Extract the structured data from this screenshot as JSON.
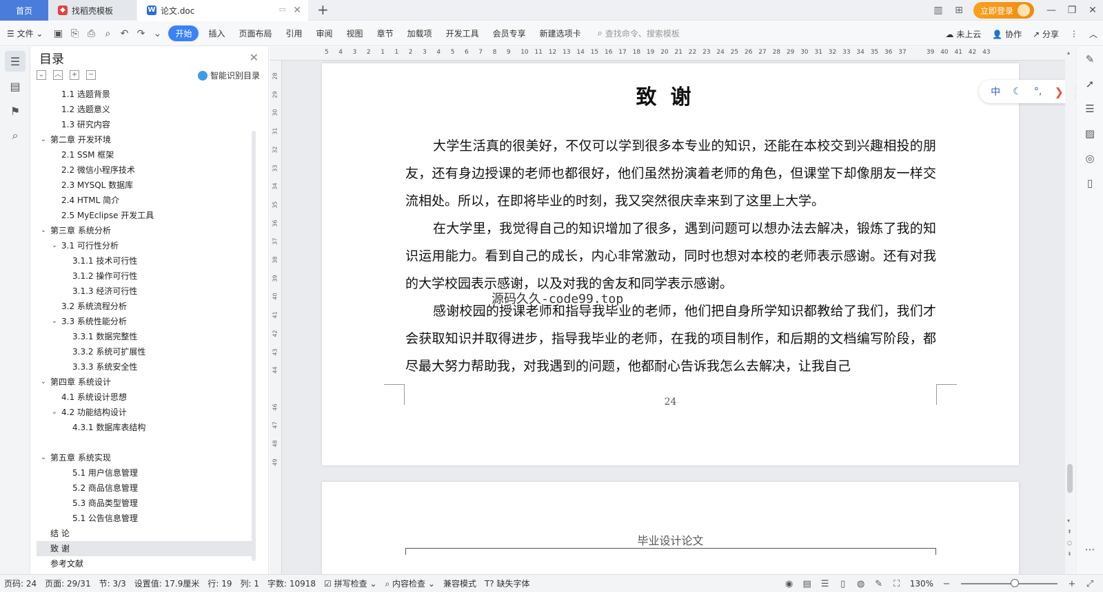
{
  "tabs": {
    "home": "首页",
    "template": "找稻壳模板",
    "document": "论文.doc"
  },
  "titlebar": {
    "login": "立即登录"
  },
  "menu": {
    "file": "文件",
    "items": [
      "开始",
      "插入",
      "页面布局",
      "引用",
      "审阅",
      "视图",
      "章节",
      "加载项",
      "开发工具",
      "会员专享",
      "新建选项卡"
    ],
    "search_placeholder": "查找命令、搜索模板",
    "cloud": "未上云",
    "collab": "协作",
    "share": "分享"
  },
  "toc": {
    "title": "目录",
    "smart": "智能识别目录",
    "items": [
      {
        "label": "1.1 选题背景",
        "level": 2
      },
      {
        "label": "1.2  选题意义",
        "level": 2
      },
      {
        "label": "1.3  研究内容",
        "level": 2
      },
      {
        "label": "第二章  开发环境",
        "level": 1,
        "expanded": true
      },
      {
        "label": "2.1 SSM 框架",
        "level": 2
      },
      {
        "label": "2.2 微信小程序技术",
        "level": 2
      },
      {
        "label": "2.3 MYSQL 数据库",
        "level": 2
      },
      {
        "label": "2.4 HTML 简介",
        "level": 2
      },
      {
        "label": "2.5 MyEclipse 开发工具",
        "level": 2
      },
      {
        "label": "第三章  系统分析",
        "level": 1,
        "expanded": true
      },
      {
        "label": "3.1 可行性分析",
        "level": 2,
        "expanded": true
      },
      {
        "label": "3.1.1 技术可行性",
        "level": 3
      },
      {
        "label": "3.1.2 操作可行性",
        "level": 3
      },
      {
        "label": "3.1.3 经济可行性",
        "level": 3
      },
      {
        "label": "3.2 系统流程分析",
        "level": 2
      },
      {
        "label": "3.3 系统性能分析",
        "level": 2,
        "expanded": true
      },
      {
        "label": "3.3.1 数据完整性",
        "level": 3
      },
      {
        "label": "3.3.2 系统可扩展性",
        "level": 3
      },
      {
        "label": "3.3.3 系统安全性",
        "level": 3
      },
      {
        "label": "第四章  系统设计",
        "level": 1,
        "expanded": true
      },
      {
        "label": "4.1  系统设计思想",
        "level": 2
      },
      {
        "label": "4.2 功能结构设计",
        "level": 2,
        "expanded": true
      },
      {
        "label": "4.3.1  数据库表结构",
        "level": 3
      },
      {
        "label": "",
        "level": 2
      },
      {
        "label": "第五章  系统实现",
        "level": 1,
        "expanded": true
      },
      {
        "label": "5.1 用户信息管理",
        "level": 3
      },
      {
        "label": "5.2  商品信息管理",
        "level": 3
      },
      {
        "label": "5.3 商品类型管理",
        "level": 3
      },
      {
        "label": "5.1 公告信息管理",
        "level": 3
      },
      {
        "label": "结    论",
        "level": 1
      },
      {
        "label": "致    谢",
        "level": 1,
        "selected": true
      },
      {
        "label": "参考文献",
        "level": 1
      }
    ]
  },
  "ruler": {
    "h": [
      "5",
      "4",
      "3",
      "2",
      "1",
      "1",
      "2",
      "3",
      "4",
      "5",
      "6",
      "7",
      "8",
      "9",
      "10",
      "11",
      "12",
      "13",
      "14",
      "15",
      "16",
      "17",
      "18",
      "19",
      "20",
      "21",
      "22",
      "23",
      "24",
      "25",
      "26",
      "27",
      "28",
      "29",
      "30",
      "31",
      "32",
      "33",
      "34",
      "35",
      "36",
      "37",
      "",
      "39",
      "40",
      "41",
      "42",
      "43"
    ],
    "v": [
      "28",
      "29",
      "30",
      "31",
      "32",
      "33",
      "34",
      "35",
      "36",
      "37",
      "38",
      "39",
      "40",
      "41",
      "42",
      "43",
      "44",
      "",
      "46",
      "47",
      "48",
      "49"
    ]
  },
  "document": {
    "title": "致谢",
    "paragraphs": [
      "大学生活真的很美好，不仅可以学到很多本专业的知识，还能在本校交到兴趣相投的朋友，还有身边授课的老师也都很好，他们虽然扮演着老师的角色，但课堂下却像朋友一样交流相处。所以，在即将毕业的时刻，我又突然很庆幸来到了这里上大学。",
      "在大学里，我觉得自己的知识增加了很多，遇到问题可以想办法去解决，锻炼了我的知识运用能力。看到自己的成长，内心非常激动，同时也想对本校的老师表示感谢。还有对我的大学校园表示感谢，以及对我的舍友和同学表示感谢。",
      "感谢校园的授课老师和指导我毕业的老师，他们把自身所学知识都教给了我们，我们才会获取知识并取得进步，指导我毕业的老师，在我的项目制作，和后期的文档编写阶段，都尽最大努力帮助我，对我遇到的问题，他都耐心告诉我怎么去解决，让我自己"
    ],
    "watermark": "源码久久-code99.top",
    "page_number": "24",
    "next_header": "毕业设计论文"
  },
  "lang_float": {
    "lang": "中"
  },
  "status": {
    "page_code": "页码: 24",
    "page": "页面: 29/31",
    "section": "节: 3/3",
    "setting": "设置值: 17.9厘米",
    "row": "行: 19",
    "col": "列: 1",
    "words": "字数: 10918",
    "spell": "拼写检查",
    "content": "内容检查",
    "compat": "兼容模式",
    "missing_font": "缺失字体",
    "zoom": "130%"
  }
}
